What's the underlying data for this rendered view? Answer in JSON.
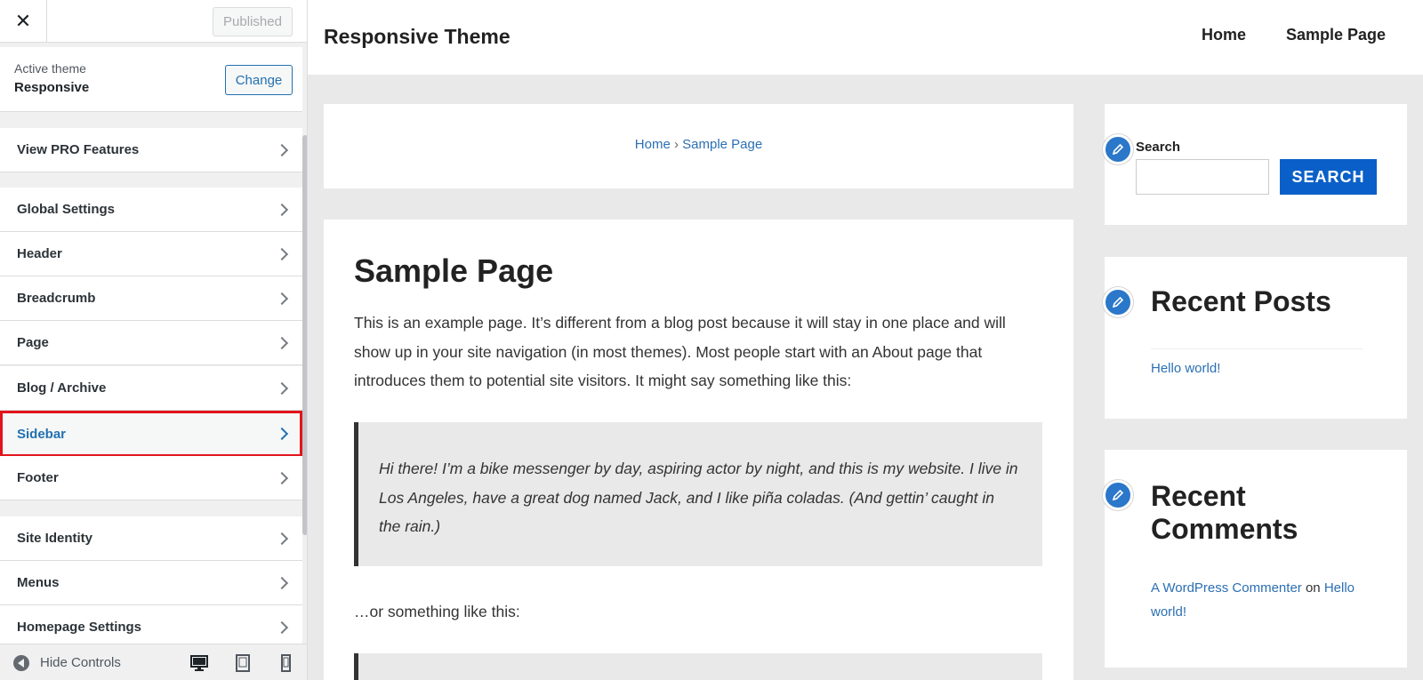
{
  "customizer": {
    "close_icon": "close-icon",
    "published_label": "Published",
    "active_theme_label": "Active theme",
    "active_theme_name": "Responsive",
    "change_label": "Change",
    "items": [
      {
        "label": "View PRO Features"
      },
      {
        "label": "Global Settings"
      },
      {
        "label": "Header"
      },
      {
        "label": "Breadcrumb"
      },
      {
        "label": "Page"
      },
      {
        "label": "Blog / Archive"
      },
      {
        "label": "Sidebar"
      },
      {
        "label": "Footer"
      },
      {
        "label": "Site Identity"
      },
      {
        "label": "Menus"
      },
      {
        "label": "Homepage Settings"
      }
    ],
    "active_item": "Sidebar",
    "highlight_color": "#e2141b",
    "footer": {
      "hide_controls_label": "Hide Controls",
      "device_icons": [
        "desktop-icon",
        "tablet-icon",
        "mobile-icon"
      ]
    }
  },
  "site": {
    "title": "Responsive Theme",
    "nav": [
      "Home",
      "Sample Page"
    ],
    "breadcrumb": {
      "home": "Home",
      "separator": "›",
      "current": "Sample Page"
    },
    "page": {
      "title": "Sample Page",
      "intro": "This is an example page. It’s different from a blog post because it will stay in one place and will show up in your site navigation (in most themes). Most people start with an About page that introduces them to potential site visitors. It might say something like this:",
      "quote": "Hi there! I’m a bike messenger by day, aspiring actor by night, and this is my website. I live in Los Angeles, have a great dog named Jack, and I like piña coladas. (And gettin’ caught in the rain.)",
      "after_quote": "…or something like this:"
    },
    "sidebar": {
      "search_label": "Search",
      "search_value": "",
      "search_button": "SEARCH",
      "recent_posts_title": "Recent Posts",
      "recent_posts": [
        "Hello world!"
      ],
      "recent_comments_title": "Recent Comments",
      "recent_comment": {
        "author": "A WordPress Commenter",
        "on": "on",
        "post": "Hello world!"
      },
      "widget_icon": "pencil-icon",
      "accent_color": "#2b77c9",
      "button_color": "#0a60c8"
    }
  }
}
